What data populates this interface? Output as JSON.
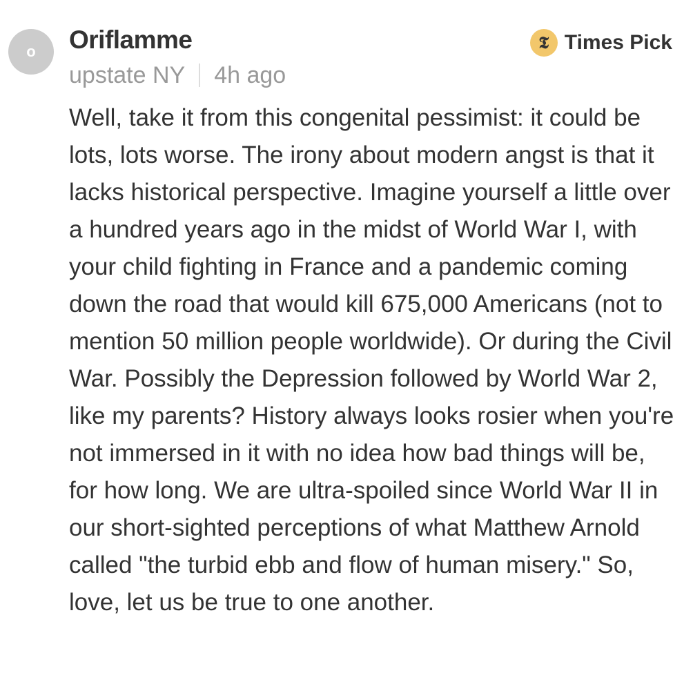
{
  "comment": {
    "avatar_initial": "o",
    "username": "Oriflamme",
    "location": "upstate NY",
    "timestamp": "4h ago",
    "badge": {
      "icon": "nyt-logo-icon",
      "label": "Times Pick",
      "color": "#f2c76b"
    },
    "body": "Well, take it from this congenital pessimist: it could be lots, lots worse. The irony about modern angst is that it lacks historical perspective. Imagine yourself a little over a hundred years ago in the midst of World War I, with your child fighting in France and a pandemic coming down the road that would kill 675,000 Americans (not to mention 50 million people worldwide). Or during the Civil War. Possibly the Depression followed by World War 2, like my parents? History always looks rosier when you're not immersed in it with no idea how bad things will be, for how long. We are ultra-spoiled since World War II in our short-sighted perceptions of what Matthew Arnold called \"the turbid ebb and flow of human misery.\" So, love, let us be true to one another."
  }
}
